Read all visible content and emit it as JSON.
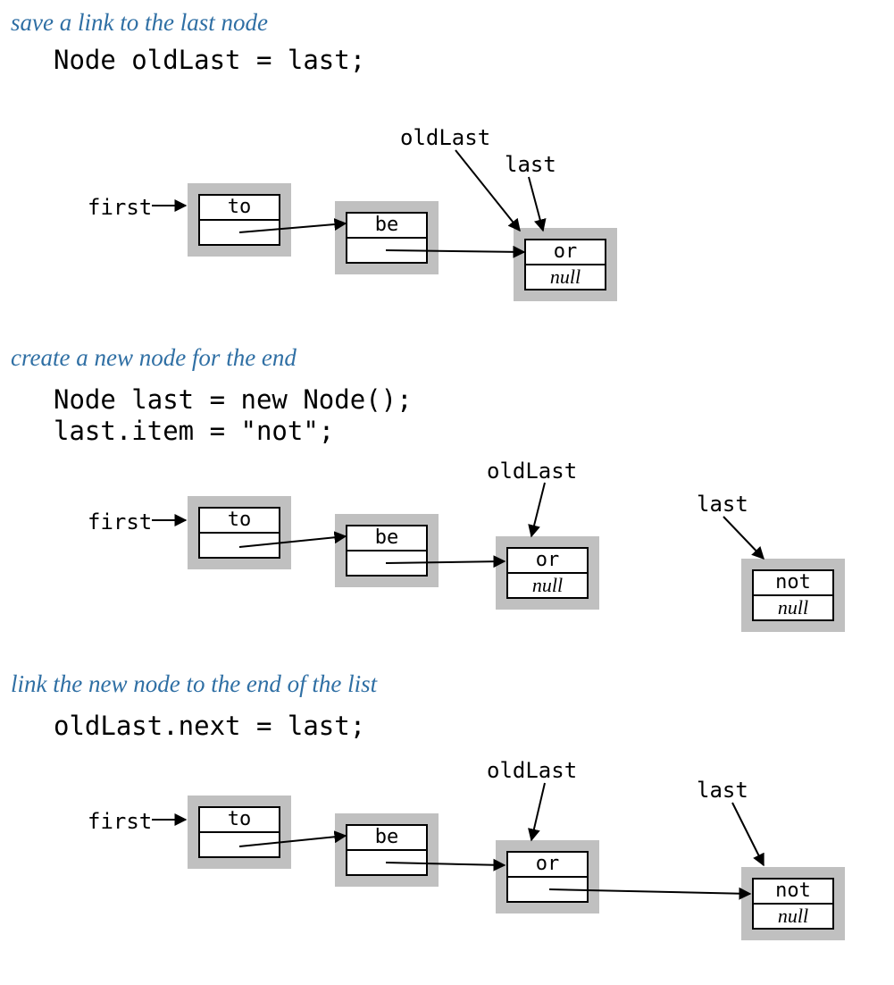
{
  "steps": [
    {
      "title": "save a link to the last node",
      "code": [
        "Node oldLast = last;"
      ],
      "labels": {
        "first": "first",
        "oldLast": "oldLast",
        "last": "last"
      },
      "nodes": [
        {
          "item": "to",
          "next": ""
        },
        {
          "item": "be",
          "next": ""
        },
        {
          "item": "or",
          "next": "null"
        }
      ]
    },
    {
      "title": "create a new node for the end",
      "code": [
        "Node last = new Node();",
        "last.item = \"not\";"
      ],
      "labels": {
        "first": "first",
        "oldLast": "oldLast",
        "last": "last"
      },
      "nodes": [
        {
          "item": "to",
          "next": ""
        },
        {
          "item": "be",
          "next": ""
        },
        {
          "item": "or",
          "next": "null"
        },
        {
          "item": "not",
          "next": "null"
        }
      ]
    },
    {
      "title": "link the new node to the end of the list",
      "code": [
        "oldLast.next = last;"
      ],
      "labels": {
        "first": "first",
        "oldLast": "oldLast",
        "last": "last"
      },
      "nodes": [
        {
          "item": "to",
          "next": ""
        },
        {
          "item": "be",
          "next": ""
        },
        {
          "item": "or",
          "next": ""
        },
        {
          "item": "not",
          "next": "null"
        }
      ]
    }
  ]
}
